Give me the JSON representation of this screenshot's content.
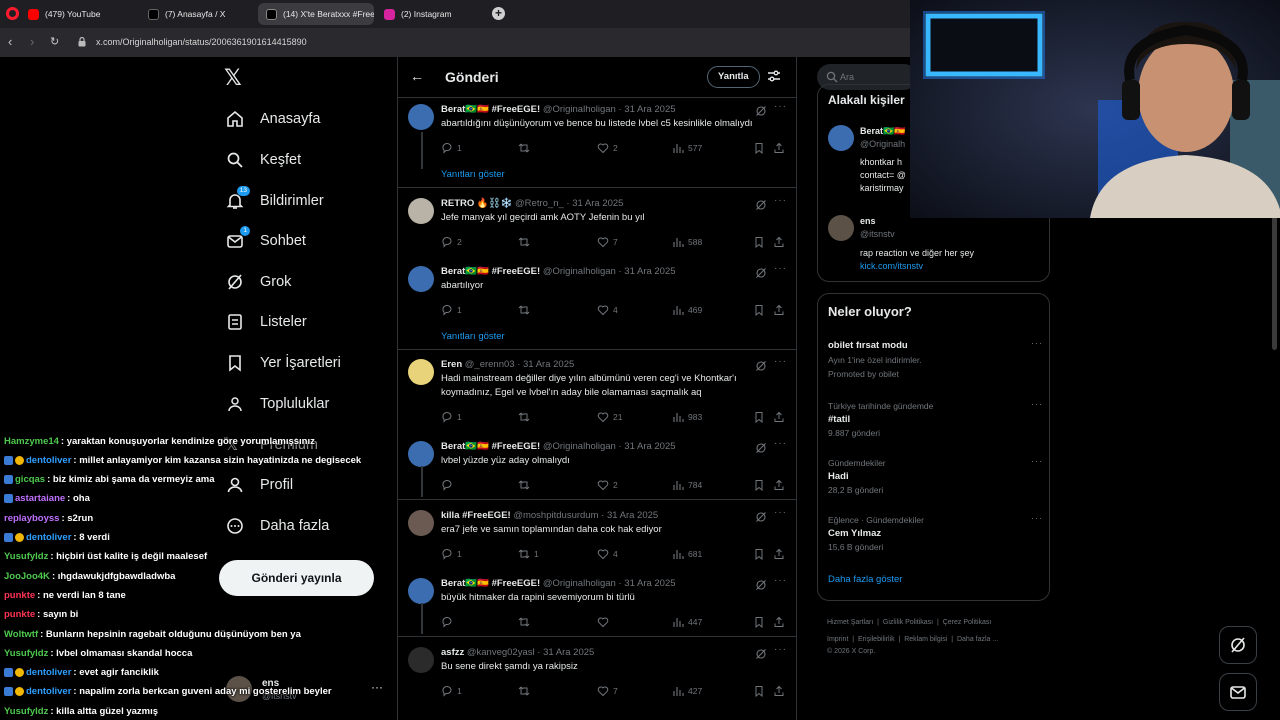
{
  "browser": {
    "tabs": [
      {
        "label": "(479) YouTube",
        "color": "#ff0000"
      },
      {
        "label": "(7) Anasayfa / X",
        "color": "#000000"
      },
      {
        "label": "(14) X'te Beratxxx #FreeE",
        "color": "#000000"
      },
      {
        "label": "(2) Instagram",
        "color": "#d6249f"
      }
    ],
    "url": "x.com/Originalholigan/status/2006361901614415890"
  },
  "sidebar": {
    "items": [
      {
        "label": "Anasayfa",
        "icon": "home-icon"
      },
      {
        "label": "Keşfet",
        "icon": "search-icon"
      },
      {
        "label": "Bildirimler",
        "icon": "bell-icon",
        "badge": "13"
      },
      {
        "label": "Sohbet",
        "icon": "mail-icon",
        "badge": "1"
      },
      {
        "label": "Grok",
        "icon": "grok-icon"
      },
      {
        "label": "Listeler",
        "icon": "list-icon"
      },
      {
        "label": "Yer İşaretleri",
        "icon": "bookmark-icon"
      },
      {
        "label": "Topluluklar",
        "icon": "communities-icon"
      },
      {
        "label": "Premium",
        "icon": "x-premium-icon"
      },
      {
        "label": "Profil",
        "icon": "profile-icon"
      },
      {
        "label": "Daha fazla",
        "icon": "more-circle-icon"
      }
    ],
    "post_button": "Gönderi yayınla",
    "account": {
      "name": "ens",
      "handle": "@itsnstv"
    }
  },
  "header": {
    "title": "Gönderi",
    "reply_button": "Yanıtla"
  },
  "show_replies_label": "Yanıtları göster",
  "tweets": [
    {
      "name": "Berat🇧🇷🇪🇸 #FreeEGE!",
      "handle": "@Originalholigan",
      "date": "31 Ara 2025",
      "text": "abartıldığını düşünüyorum ve bence bu listede lvbel c5 kesinlikle olmalıydı",
      "replies": "1",
      "retweets": "",
      "likes": "2",
      "views": "577"
    },
    {
      "name": "RETRO 🔥⛓️❄️",
      "handle": "@Retro_n_",
      "date": "31 Ara 2025",
      "text": "Jefe manyak yıl geçirdi amk AOTY Jefenin bu yıl",
      "replies": "2",
      "retweets": "",
      "likes": "7",
      "views": "588"
    },
    {
      "name": "Berat🇧🇷🇪🇸 #FreeEGE!",
      "handle": "@Originalholigan",
      "date": "31 Ara 2025",
      "text": "abartılıyor",
      "replies": "1",
      "retweets": "",
      "likes": "4",
      "views": "469"
    },
    {
      "name": "Eren",
      "handle": "@_erenn03",
      "date": "31 Ara 2025",
      "text": "Hadi mainstream değiller diye yılın albümünü veren ceg'i ve Khontkar'ı koymadınız, Egel ve lvbel'ın aday bile olamaması saçmalık aq",
      "replies": "1",
      "retweets": "",
      "likes": "21",
      "views": "983"
    },
    {
      "name": "Berat🇧🇷🇪🇸 #FreeEGE!",
      "handle": "@Originalholigan",
      "date": "31 Ara 2025",
      "text": "lvbel yüzde yüz aday olmalıydı",
      "replies": "",
      "retweets": "",
      "likes": "2",
      "views": "784"
    },
    {
      "name": "killa #FreeEGE!",
      "handle": "@moshpitdusurdum",
      "date": "31 Ara 2025",
      "text": "era7 jefe ve samın toplamından daha cok hak ediyor",
      "replies": "1",
      "retweets": "1",
      "likes": "4",
      "views": "681"
    },
    {
      "name": "Berat🇧🇷🇪🇸 #FreeEGE!",
      "handle": "@Originalholigan",
      "date": "31 Ara 2025",
      "text": "büyük hitmaker da rapini sevemiyorum bi türlü",
      "replies": "",
      "retweets": "",
      "likes": "",
      "views": "447"
    },
    {
      "name": "asfzz",
      "handle": "@kanveg02yasl",
      "date": "31 Ara 2025",
      "text": "Bu sene direkt şamdı ya rakipsiz",
      "replies": "1",
      "retweets": "",
      "likes": "7",
      "views": "427"
    }
  ],
  "search": {
    "placeholder": "Ara"
  },
  "related": {
    "title": "Alakalı kişiler",
    "users": [
      {
        "name": "Berat🇧🇷🇪🇸",
        "handle": "@Originalh",
        "bio1": "khontkar h",
        "bio2": "contact= @",
        "bio3": "karistirmay"
      },
      {
        "name": "ens",
        "handle": "@itsnstv",
        "bio1": "rap reaction ve diğer her şey",
        "bio2": "kick.com/itsnstv"
      }
    ]
  },
  "trends": {
    "title": "Neler oluyor?",
    "items": [
      {
        "context": "",
        "title": "obilet fırsat modu",
        "sub": "Ayın 1'ine özel indirimler.",
        "count": "Promoted by obilet"
      },
      {
        "context": "Türkiye tarihinde gündemde",
        "title": "#tatil",
        "count": "9.887 gönderi"
      },
      {
        "context": "Gündemdekiler",
        "title": "Hadi",
        "count": "28,2 B gönderi"
      },
      {
        "context": "Eğlence · Gündemdekiler",
        "title": "Cem Yılmaz",
        "count": "15,6 B gönderi"
      }
    ],
    "show_more": "Daha fazla göster"
  },
  "footer": {
    "links": [
      "Hizmet Şartları",
      "Gizlilik Politikası",
      "Çerez Politikası",
      "Imprint",
      "Erişilebilirlik",
      "Reklam bilgisi",
      "Daha fazla ..."
    ],
    "copyright": "© 2026 X Corp."
  },
  "chat": [
    {
      "user": "Hamzyme14",
      "color": "#4ec94e",
      "badge": "",
      "text": ": yaraktan konuşuyorlar kendinize göre yorumlamışsınız"
    },
    {
      "user": "dentoliver",
      "color": "#2e9fff",
      "badge": "dual",
      "text": ": millet anlayamiyor kim kazansa sizin hayatinizda ne degisecek"
    },
    {
      "user": "gicqas",
      "color": "#4ec94e",
      "badge": "blue",
      "text": ": biz kimiz abi şama da vermeyiz ama"
    },
    {
      "user": "astartaiane",
      "color": "#c070ff",
      "badge": "blue",
      "text": ": oha"
    },
    {
      "user": "replayboyss",
      "color": "#c070ff",
      "badge": "",
      "text": ": s2run"
    },
    {
      "user": "dentoliver",
      "color": "#2e9fff",
      "badge": "dual",
      "text": ": 8 verdi"
    },
    {
      "user": "Yusufyldz",
      "color": "#4ec94e",
      "badge": "",
      "text": ": hiçbiri üst kalite iş değil maalesef"
    },
    {
      "user": "JooJoo4K",
      "color": "#4ec94e",
      "badge": "",
      "text": ": ıhgdawukjdfgbawdladwba"
    },
    {
      "user": "punkte",
      "color": "#ff3355",
      "badge": "",
      "text": ": ne verdi lan 8 tane"
    },
    {
      "user": "punkte",
      "color": "#ff3355",
      "badge": "",
      "text": ": sayın bi"
    },
    {
      "user": "Woltwtf",
      "color": "#4ec94e",
      "badge": "",
      "text": ": Bunların hepsinin ragebait olduğunu düşünüyom ben ya"
    },
    {
      "user": "Yusufyldz",
      "color": "#4ec94e",
      "badge": "",
      "text": ": lvbel olmaması skandal hocca"
    },
    {
      "user": "dentoliver",
      "color": "#2e9fff",
      "badge": "dual",
      "text": ": evet agir fanciklik"
    },
    {
      "user": "dentoliver",
      "color": "#2e9fff",
      "badge": "dual",
      "text": ": napalim zorla berkcan guveni aday mi gosterelim beyler"
    },
    {
      "user": "Yusufyldz",
      "color": "#4ec94e",
      "badge": "",
      "text": ": killa altta güzel yazmış"
    }
  ]
}
